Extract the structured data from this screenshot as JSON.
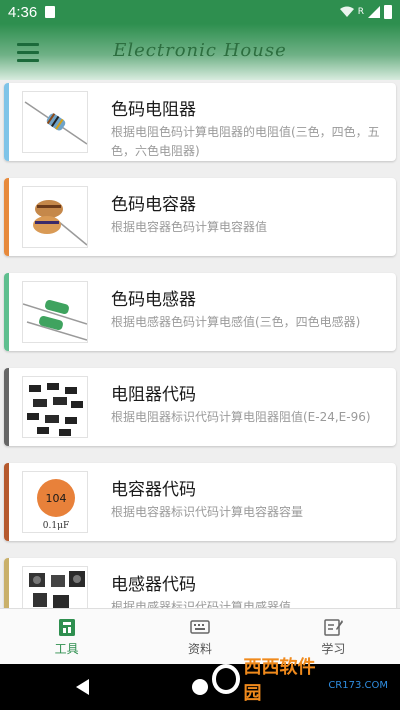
{
  "status_bar": {
    "time": "4:36",
    "network_label": "R"
  },
  "app_bar": {
    "title": "Electronic House",
    "menu_icon": "menu-icon"
  },
  "colors": {
    "primary": "#2e8f4f",
    "accent_blue": "#7fc4e8",
    "accent_orange": "#e78a3c",
    "accent_green": "#5fbf8f",
    "accent_gray": "#666666",
    "accent_rust": "#b65a2e",
    "accent_tan": "#c9b06a"
  },
  "items": [
    {
      "title": "色码电阻器",
      "desc": "根据电阻色码计算电阻器的电阻值(三色，四色，五色，六色电阻器)"
    },
    {
      "title": "色码电容器",
      "desc": "根据电容器色码计算电容器值"
    },
    {
      "title": "色码电感器",
      "desc": "根据电感器色码计算电感值(三色，四色电感器)"
    },
    {
      "title": "电阻器代码",
      "desc": "根据电阻器标识代码计算电阻器阻值(E-24,E-96)"
    },
    {
      "title": "电容器代码",
      "desc": "根据电容器标识代码计算电容器容量",
      "thumb_code": "104",
      "thumb_value": "0.1μF"
    },
    {
      "title": "电感器代码",
      "desc": "根据电感器标识代码计算电感器值"
    }
  ],
  "bottom_nav": [
    {
      "label": "工具",
      "icon": "toolbox-icon",
      "active": true
    },
    {
      "label": "资料",
      "icon": "keyboard-icon",
      "active": false
    },
    {
      "label": "学习",
      "icon": "edit-note-icon",
      "active": false
    }
  ],
  "watermark": {
    "text": "西西软件园",
    "sub": "CR173.COM"
  }
}
